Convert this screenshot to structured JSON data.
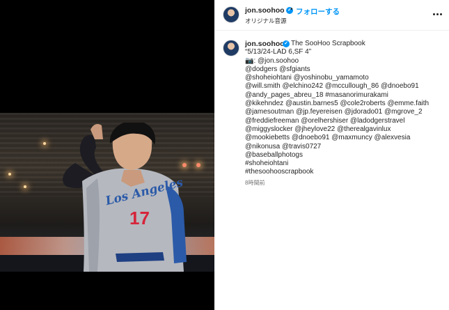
{
  "header": {
    "username": "jon.soohoo",
    "follow_label": "フォローする",
    "audio_label": "オリジナル音源"
  },
  "caption": {
    "username": "jon.soohoo",
    "source_title": "The SooHoo Scrapbook",
    "lines": [
      "“5/13/24-LAD 6,SF 4”",
      "📷: @jon.soohoo",
      "@dodgers @sfgiants",
      "@shoheiohtani @yoshinobu_yamamoto",
      "@will.smith @elchino242 @mccullough_86 @dnoebo91",
      "@andy_pages_abreu_18 #masanorimurakami",
      "@kikehndez @austin.barnes5 @cole2roberts @emme.faith",
      "@jamesoutman @jp.feyereisen @jdorado01 @mgrove_2",
      "@freddiefreeman @orelhershiser @ladodgerstravel",
      "@miggyslocker @jheylove22 @therealgavinlux",
      "@mookiebetts @dnoebo91 @maxmuncy @alexvesia",
      "@nikonusa @travis0727",
      "@baseballphotogs",
      "#shoheiohtani",
      "#thesoohooscrapbook"
    ],
    "timestamp": "8時間前"
  },
  "photo": {
    "jersey_text": "Los Angeles",
    "jersey_number": "17"
  },
  "colors": {
    "accent": "#0095f6",
    "text": "#262626",
    "muted": "#737373",
    "jersey_blue": "#2b5aa8",
    "jersey_red": "#d6243a"
  },
  "icons": {
    "verified": "verified-badge-icon",
    "more": "more-options-icon"
  }
}
